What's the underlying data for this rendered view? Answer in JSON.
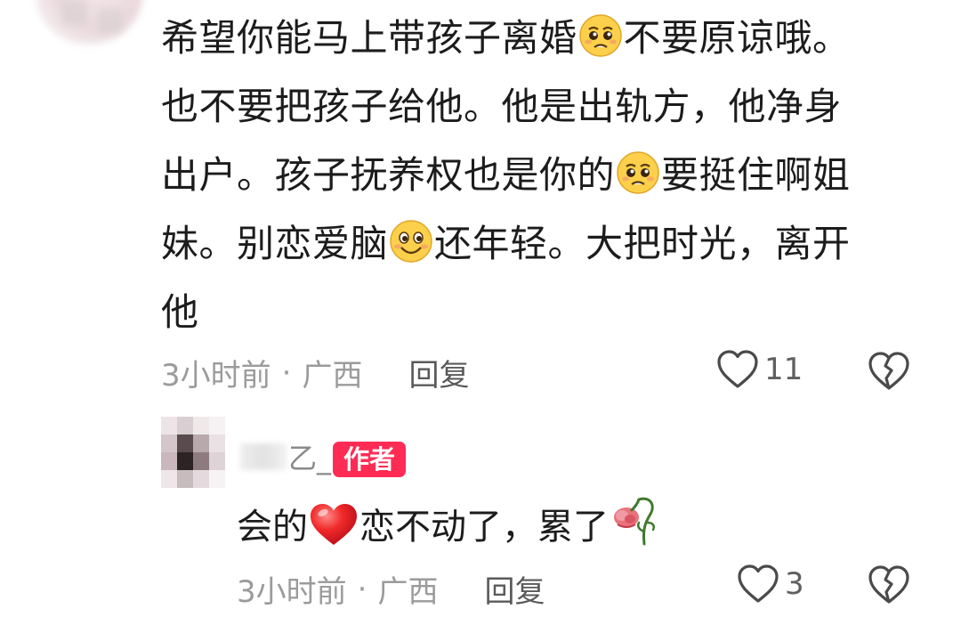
{
  "comment": {
    "lines": [
      "希望你能马上带孩子离婚",
      "不要原谅哦。",
      "也不要把孩子给他。他是出轨方，他净身",
      "出户。孩子抚养权也是你的",
      "要挺住啊姐",
      "妹。别恋爱脑",
      "还年轻。大把时光，离开",
      "他"
    ],
    "time": "3小时前",
    "separator": "·",
    "location": "广西",
    "reply_label": "回复",
    "likes": "11"
  },
  "reply": {
    "author_suffix": "乙_",
    "badge": "作者",
    "text_parts": [
      "会的",
      "恋不动了，累了"
    ],
    "time": "3小时前",
    "separator": "·",
    "location": "广西",
    "reply_label": "回复",
    "likes": "3"
  },
  "icons": {
    "pleading_face": "pleading-face-emoji",
    "smile_face": "grinning-face-emoji",
    "heart": "red-heart-emoji",
    "wilted_rose": "wilted-flower-emoji",
    "like": "heart-outline-icon",
    "dislike": "broken-heart-outline-icon"
  },
  "colors": {
    "badge": "#fe2c55",
    "meta_text": "#9b9b9b",
    "body_text": "#1c1c1c"
  }
}
